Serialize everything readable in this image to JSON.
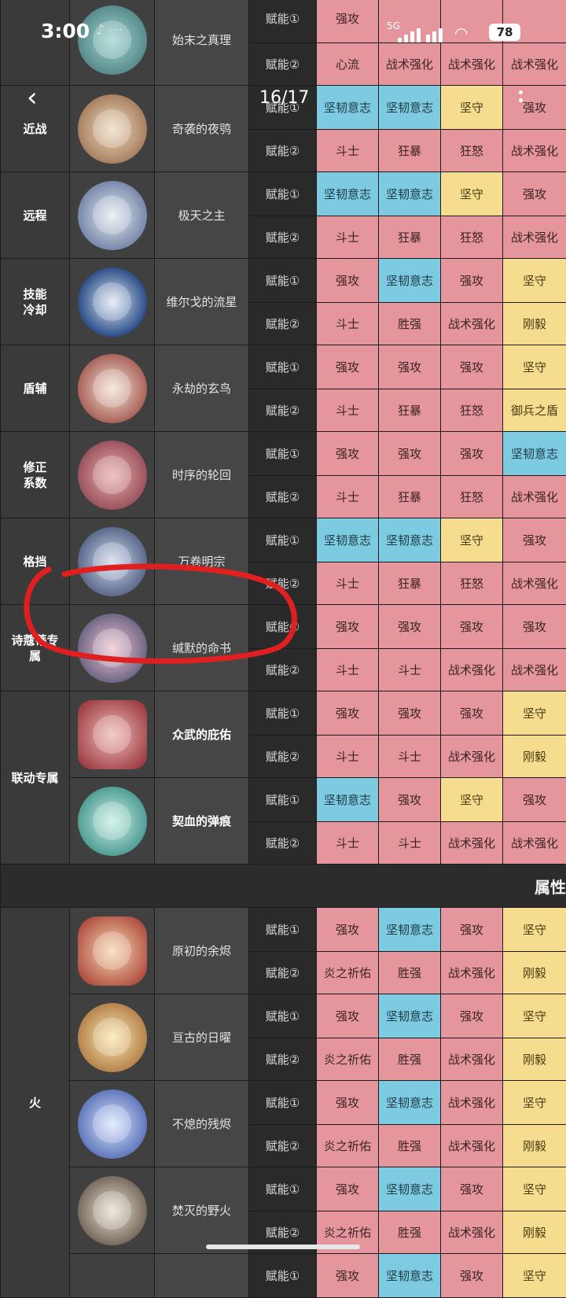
{
  "status_bar": {
    "time": "3:00",
    "signal": "5G",
    "signal2": "G",
    "battery": "78"
  },
  "viewer": {
    "page_indicator": "16/17"
  },
  "slot1": "赋能①",
  "slot2": "赋能②",
  "section_attribute": "属性",
  "cells": {
    "a": "强攻",
    "b": "坚韧意志",
    "c": "坚守",
    "d": "斗士",
    "e": "狂暴",
    "f": "狂怒",
    "g": "战术强化",
    "h": "胜强",
    "i": "刚毅",
    "j": "御兵之盾",
    "k": "心流",
    "l": "炎之祈佑"
  },
  "rows": [
    {
      "category": "",
      "name": "始末之真理",
      "icon": "compass-emblem-icon"
    },
    {
      "category": "近战",
      "name": "奇袭的夜鸮",
      "icon": "owl-emblem-icon"
    },
    {
      "category": "远程",
      "name": "极天之主",
      "icon": "dragon-emblem-icon"
    },
    {
      "category": "技能冷却",
      "name": "维尔戈的流星",
      "icon": "meteor-emblem-icon"
    },
    {
      "category": "盾辅",
      "name": "永劫的玄鸟",
      "icon": "phoenix-emblem-icon"
    },
    {
      "category": "修正系数",
      "name": "时序的轮回",
      "icon": "clock-emblem-icon"
    },
    {
      "category": "格挡",
      "name": "万卷明宗",
      "icon": "book-emblem-icon"
    },
    {
      "category": "诗蔻蒂专属",
      "name": "缄默的命书",
      "icon": "fate-book-emblem-icon"
    },
    {
      "category": "联动专属",
      "name": "众武的庇佑",
      "icon": "crossed-swords-emblem-icon"
    },
    {
      "category": "",
      "name": "契血的弹痕",
      "icon": "cross-emblem-icon"
    },
    {
      "category": "火",
      "name": "原初的余烬",
      "icon": "flame-emblem-icon"
    },
    {
      "category": "",
      "name": "亘古的日曜",
      "icon": "sun-emblem-icon"
    },
    {
      "category": "",
      "name": "不熄的残烬",
      "icon": "blue-flame-emblem-icon"
    },
    {
      "category": "",
      "name": "焚灭的野火",
      "icon": "claw-emblem-icon"
    },
    {
      "category": "",
      "name": "",
      "icon": ""
    }
  ],
  "colors": {
    "pink": "#e4969c",
    "blue": "#7dcbe0",
    "yellow": "#f5dc8f",
    "annotation_red": "#e02020"
  }
}
